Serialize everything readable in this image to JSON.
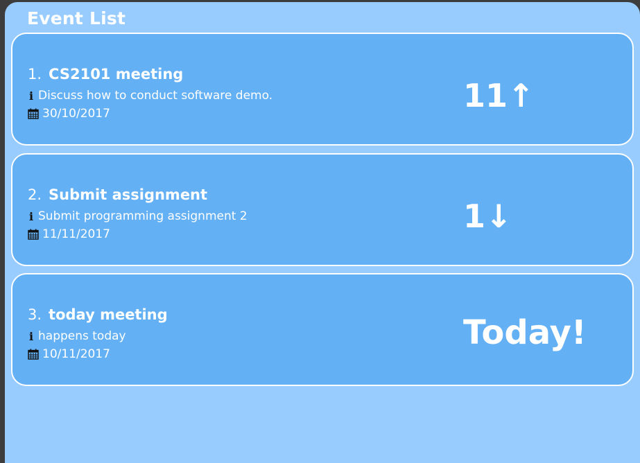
{
  "panel": {
    "title": "Event List"
  },
  "events": [
    {
      "index": "1.",
      "name": "CS2101 meeting",
      "description": "Discuss how to conduct software demo.",
      "date": "30/10/2017",
      "countdown": "11↑"
    },
    {
      "index": "2.",
      "name": "Submit assignment",
      "description": "Submit programming assignment 2",
      "date": "11/11/2017",
      "countdown": "1↓"
    },
    {
      "index": "3.",
      "name": "today meeting",
      "description": "happens today",
      "date": "10/11/2017",
      "countdown": "Today!"
    }
  ],
  "icons": {
    "description": "info-icon",
    "date": "calendar-icon"
  },
  "colors": {
    "panel_background": "#99ccfe",
    "card_background": "#63b0f4",
    "card_border": "#ffffff",
    "text": "#ffffff"
  }
}
